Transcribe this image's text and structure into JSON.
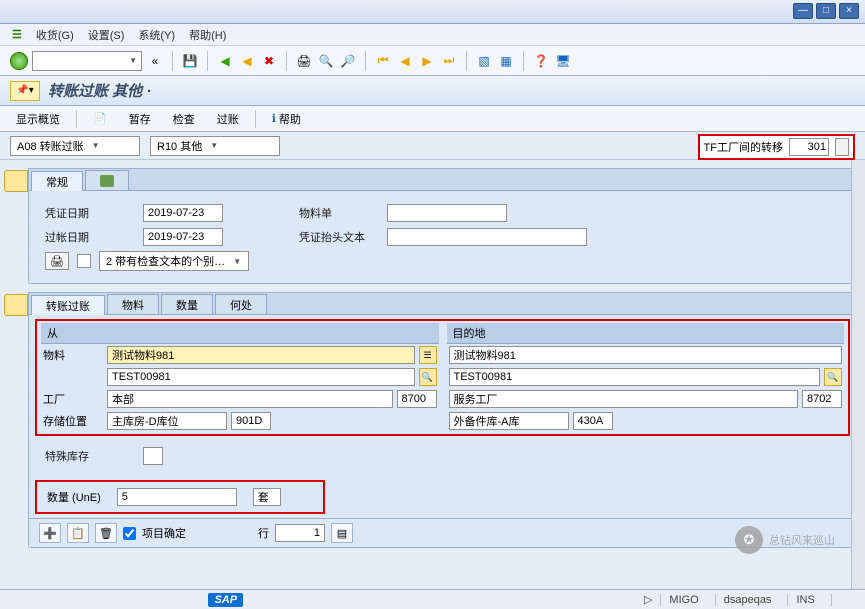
{
  "menubar": {
    "items": [
      "收货(G)",
      "设置(S)",
      "系统(Y)",
      "帮助(H)"
    ]
  },
  "titlebar": {
    "title": "转账过账 其他 ·"
  },
  "app_toolbar": {
    "overview": "显示概览",
    "hold": "暂存",
    "check": "检查",
    "post": "过账",
    "help": "帮助"
  },
  "selectors": {
    "left": "A08 转账过账",
    "right": "R10 其他"
  },
  "tf": {
    "label": "TF工厂间的转移",
    "code": "301"
  },
  "header_tabs": {
    "general": "常规"
  },
  "header": {
    "doc_date_label": "凭证日期",
    "doc_date": "2019-07-23",
    "post_date_label": "过帐日期",
    "post_date": "2019-07-23",
    "mat_slip_label": "物料单",
    "doc_head_label": "凭证抬头文本",
    "text_option": "2 带有检查文本的个别…"
  },
  "item_tabs": {
    "transfer": "转账过账",
    "material": "物料",
    "qty": "数量",
    "where": "何处"
  },
  "from": {
    "head": "从",
    "material_label": "物料",
    "material": "测试物料981",
    "desc": "TEST00981",
    "plant_label": "工厂",
    "plant_name": "本部",
    "plant": "8700",
    "sloc_label": "存储位置",
    "sloc_name": "主库房-D库位",
    "sloc": "901D"
  },
  "to": {
    "head": "目的地",
    "material": "测试物料981",
    "desc": "TEST00981",
    "plant_name": "服务工厂",
    "plant": "8702",
    "sloc_name": "外备件库-A库",
    "sloc": "430A"
  },
  "special": {
    "label": "特殊库存"
  },
  "qty": {
    "label": "数量 (UnE)",
    "value": "5",
    "unit": "套"
  },
  "bottom": {
    "item_ok": "项目确定",
    "line_label": "行",
    "line": "1"
  },
  "status": {
    "tcode": "MIGO",
    "sys": "dsapeqas",
    "ovr": "INS"
  },
  "watermark": "总钻风来巡山"
}
